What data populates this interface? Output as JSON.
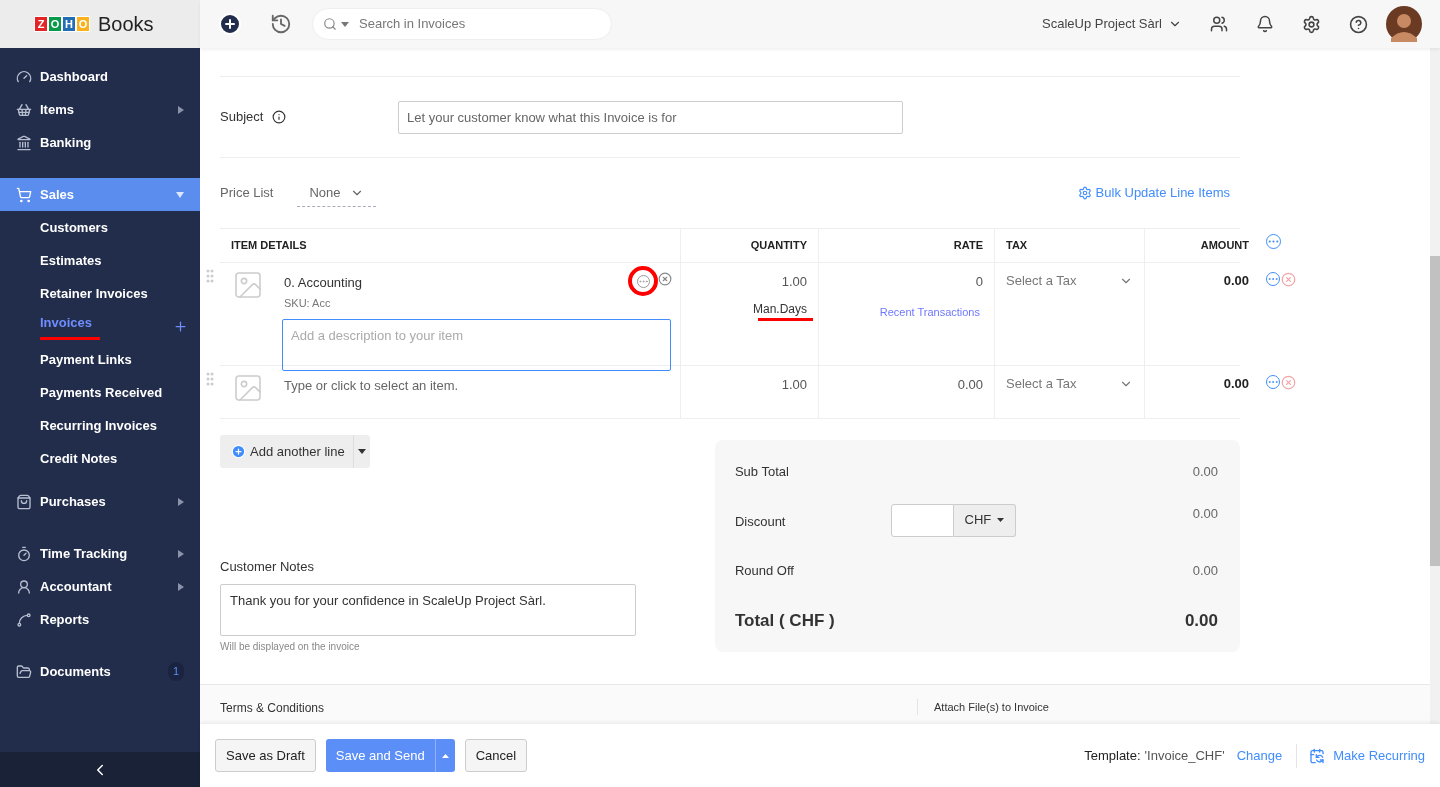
{
  "logo": {
    "letters": [
      {
        "char": "Z",
        "color": "#e42527"
      },
      {
        "char": "O",
        "color": "#089949"
      },
      {
        "char": "H",
        "color": "#226db4"
      },
      {
        "char": "O",
        "color": "#f9b21d"
      }
    ],
    "product": "Books"
  },
  "header": {
    "search_placeholder": "Search in Invoices",
    "organization": "ScaleUp Project Sàrl"
  },
  "sidebar": {
    "groups": [
      [
        {
          "label": "Dashboard",
          "has_submenu": false,
          "selected": false
        },
        {
          "label": "Items",
          "has_submenu": true,
          "expanded": false,
          "selected": false
        },
        {
          "label": "Banking",
          "has_submenu": false,
          "selected": false
        }
      ],
      [
        {
          "label": "Sales",
          "has_submenu": true,
          "expanded": true,
          "selected": true,
          "children": [
            {
              "label": "Customers",
              "selected": false,
              "add_button": false,
              "underlined": false
            },
            {
              "label": "Estimates",
              "selected": false,
              "add_button": false,
              "underlined": false
            },
            {
              "label": "Retainer Invoices",
              "selected": false,
              "add_button": false,
              "underlined": false
            },
            {
              "label": "Invoices",
              "selected": true,
              "add_button": true,
              "underlined": true
            },
            {
              "label": "Payment Links",
              "selected": false,
              "add_button": false,
              "underlined": false
            },
            {
              "label": "Payments Received",
              "selected": false,
              "add_button": false,
              "underlined": false
            },
            {
              "label": "Recurring Invoices",
              "selected": false,
              "add_button": false,
              "underlined": false
            },
            {
              "label": "Credit Notes",
              "selected": false,
              "add_button": false,
              "underlined": false
            }
          ]
        }
      ],
      [
        {
          "label": "Purchases",
          "has_submenu": true,
          "expanded": false,
          "selected": false
        }
      ],
      [
        {
          "label": "Time Tracking",
          "has_submenu": true,
          "expanded": false,
          "selected": false
        },
        {
          "label": "Accountant",
          "has_submenu": true,
          "expanded": false,
          "selected": false
        },
        {
          "label": "Reports",
          "has_submenu": false,
          "selected": false
        }
      ],
      [
        {
          "label": "Documents",
          "has_submenu": false,
          "selected": false,
          "badge": "1"
        }
      ]
    ]
  },
  "subject": {
    "label": "Subject",
    "placeholder": "Let your customer know what this Invoice is for"
  },
  "price_list": {
    "label": "Price List",
    "value": "None"
  },
  "bulk_update": "Bulk Update Line Items",
  "table": {
    "columns": [
      "ITEM DETAILS",
      "QUANTITY",
      "RATE",
      "TAX",
      "AMOUNT"
    ],
    "rows": [
      {
        "kind": "item",
        "name": "0. Accounting",
        "sku": "SKU: Acc",
        "description_placeholder": "Add a description to your item",
        "quantity": "1.00",
        "unit": "Man.Days",
        "unit_underlined": true,
        "rate": "0",
        "rate_link": "Recent Transactions",
        "tax_placeholder": "Select a Tax",
        "amount": "0.00",
        "more_circled": true
      },
      {
        "kind": "empty",
        "placeholder": "Type or click to select an item.",
        "quantity": "1.00",
        "rate": "0.00",
        "tax_placeholder": "Select a Tax",
        "amount": "0.00"
      }
    ]
  },
  "add_line": "Add another line",
  "totals": {
    "sub_total_label": "Sub Total",
    "sub_total": "0.00",
    "discount_label": "Discount",
    "discount_unit": "CHF",
    "discount": "0.00",
    "round_off_label": "Round Off",
    "round_off": "0.00",
    "total_label": "Total ( CHF )",
    "total": "0.00"
  },
  "notes": {
    "label": "Customer Notes",
    "value": "Thank you for your confidence in ScaleUp Project Sàrl.",
    "hint": "Will be displayed on the invoice"
  },
  "terms_label": "Terms & Conditions",
  "attach_label": "Attach File(s) to Invoice",
  "footer": {
    "save_draft": "Save as Draft",
    "save_send": "Save and Send",
    "cancel": "Cancel",
    "template_label": "Template:",
    "template_value": "'Invoice_CHF'",
    "change": "Change",
    "make_recurring": "Make Recurring"
  }
}
